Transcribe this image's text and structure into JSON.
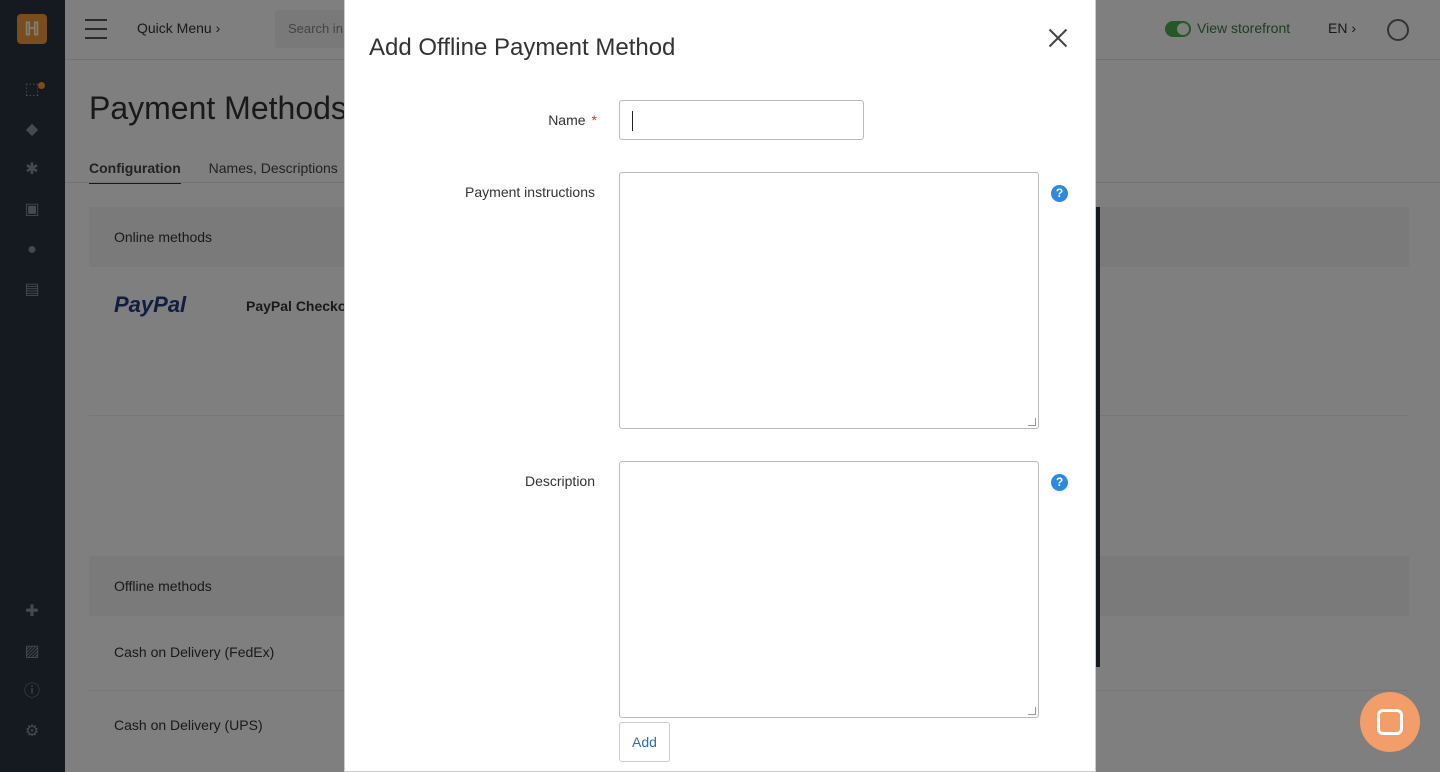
{
  "topbar": {
    "quick_menu": "Quick Menu ›",
    "search_placeholder": "Search in",
    "view_storefront": "View storefront",
    "language": "EN ›"
  },
  "page": {
    "title": "Payment Methods",
    "tabs": [
      {
        "label": "Configuration",
        "active": true
      },
      {
        "label": "Names, Descriptions",
        "active": false
      }
    ],
    "online_methods_header": "Online methods",
    "paypal_logo": "PayPal",
    "paypal_method": "PayPal Checko",
    "offline_methods_header": "Offline methods",
    "offline_rows": [
      "Cash on Delivery (FedEx)",
      "Cash on Delivery (UPS)"
    ]
  },
  "modal": {
    "title": "Add Offline Payment Method",
    "name_label": "Name",
    "required_mark": "*",
    "name_value": "",
    "payment_instructions_label": "Payment instructions",
    "payment_instructions_value": "",
    "description_label": "Description",
    "description_value": "",
    "help_glyph": "?",
    "add_button": "Add"
  },
  "colors": {
    "sidebar": "#2b3440",
    "accent": "#f29d38",
    "help": "#2d8ae0",
    "storefront_toggle": "#4caf50"
  }
}
